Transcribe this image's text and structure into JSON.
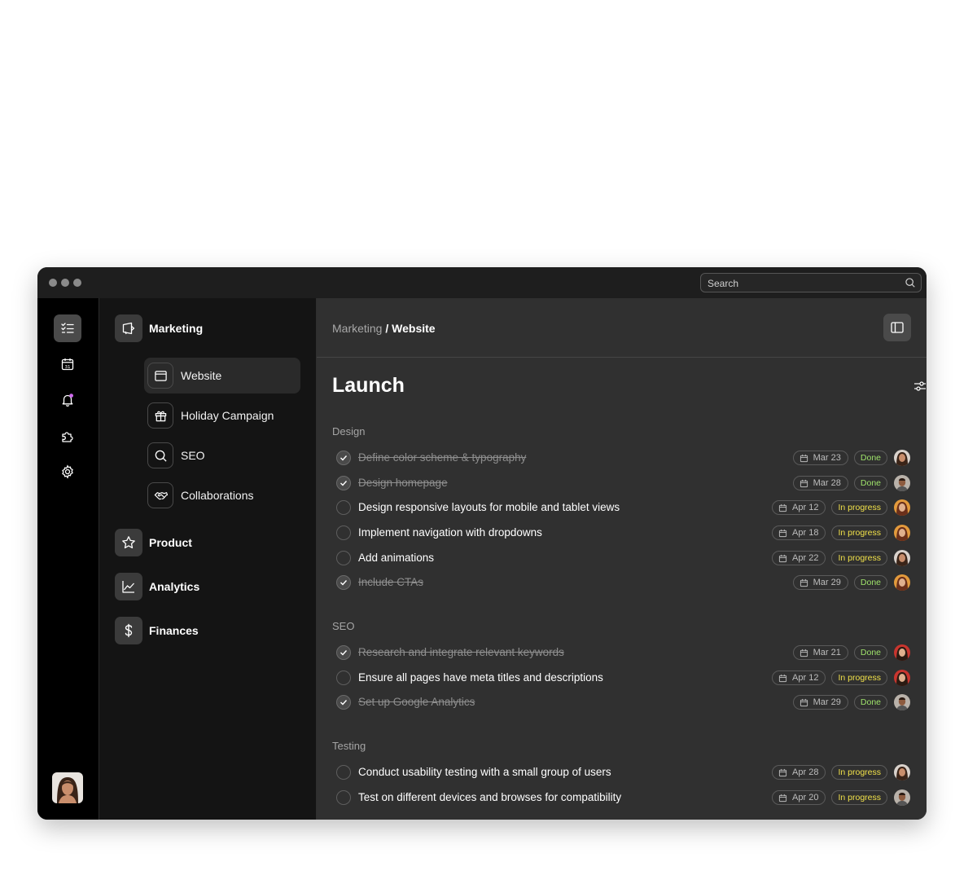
{
  "search": {
    "placeholder": "Search",
    "icon": "search-icon"
  },
  "rail": {
    "items": [
      {
        "icon": "checklist-icon",
        "active": true
      },
      {
        "icon": "calendar-icon",
        "active": false
      },
      {
        "icon": "bell-icon",
        "active": false,
        "badge_color": "#d06bf0"
      },
      {
        "icon": "puzzle-icon",
        "active": false
      },
      {
        "icon": "gear-icon",
        "active": false
      }
    ]
  },
  "nav": {
    "marketing": {
      "label": "Marketing",
      "icon": "megaphone-icon"
    },
    "sub_items": [
      {
        "label": "Website",
        "icon": "browser-window-icon",
        "active": true
      },
      {
        "label": "Holiday Campaign",
        "icon": "gift-icon",
        "active": false
      },
      {
        "label": "SEO",
        "icon": "search-icon",
        "active": false
      },
      {
        "label": "Collaborations",
        "icon": "handshake-icon",
        "active": false
      }
    ],
    "product": {
      "label": "Product",
      "icon": "star-icon"
    },
    "analytics": {
      "label": "Analytics",
      "icon": "chart-line-icon"
    },
    "finances": {
      "label": "Finances",
      "icon": "dollar-icon"
    }
  },
  "breadcrumb": {
    "parent": "Marketing",
    "separator": "/",
    "current": "Website"
  },
  "page": {
    "title": "Launch"
  },
  "colors": {
    "done": "#9fe36b",
    "in_progress": "#f2e24a",
    "background": "#303030"
  },
  "sections": [
    {
      "name": "Design",
      "tasks": [
        {
          "label": "Define color scheme & typography",
          "done": true,
          "date": "Mar 23",
          "status": "Done"
        },
        {
          "label": "Design homepage",
          "done": true,
          "date": "Mar 28",
          "status": "Done"
        },
        {
          "label": "Design responsive layouts for mobile and tablet views",
          "done": false,
          "date": "Apr 12",
          "status": "In progress"
        },
        {
          "label": "Implement navigation with dropdowns",
          "done": false,
          "date": "Apr 18",
          "status": "In progress"
        },
        {
          "label": "Add animations",
          "done": false,
          "date": "Apr 22",
          "status": "In progress"
        },
        {
          "label": "Include CTAs",
          "done": true,
          "date": "Mar 29",
          "status": "Done"
        }
      ]
    },
    {
      "name": "SEO",
      "tasks": [
        {
          "label": "Research and integrate relevant keywords",
          "done": true,
          "date": "Mar 21",
          "status": "Done"
        },
        {
          "label": "Ensure all pages have meta titles and descriptions",
          "done": false,
          "date": "Apr 12",
          "status": "In progress"
        },
        {
          "label": "Set up Google Analytics",
          "done": true,
          "date": "Mar 29",
          "status": "Done"
        }
      ]
    },
    {
      "name": "Testing",
      "tasks": [
        {
          "label": "Conduct usability testing with a small group of users",
          "done": false,
          "date": "Apr 28",
          "status": "In progress"
        },
        {
          "label": "Test on different devices and browses for compatibility",
          "done": false,
          "date": "Apr 20",
          "status": "In progress"
        }
      ]
    }
  ]
}
